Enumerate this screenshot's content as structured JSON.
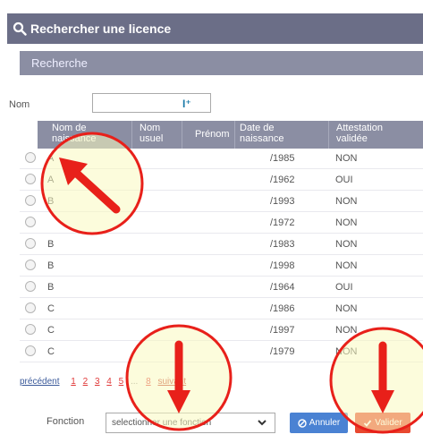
{
  "dialog": {
    "title": "Rechercher une licence",
    "section_title": "Recherche"
  },
  "search": {
    "nom_label": "Nom",
    "nom_value": ""
  },
  "table": {
    "headers": {
      "nom_naissance": "Nom de naissance",
      "nom_usuel": "Nom usuel",
      "prenom": "Prénom",
      "date_naissance": "Date de naissance",
      "attestation": "Attestation validée"
    },
    "rows": [
      {
        "initial": "A",
        "date": "/1985",
        "attestation": "NON"
      },
      {
        "initial": "A",
        "date": "/1962",
        "attestation": "OUI"
      },
      {
        "initial": "B",
        "date": "/1993",
        "attestation": "NON"
      },
      {
        "initial": "",
        "date": "/1972",
        "attestation": "NON"
      },
      {
        "initial": "B",
        "date": "/1983",
        "attestation": "NON"
      },
      {
        "initial": "B",
        "date": "/1998",
        "attestation": "NON"
      },
      {
        "initial": "B",
        "date": "/1964",
        "attestation": "OUI"
      },
      {
        "initial": "C",
        "date": "/1986",
        "attestation": "NON"
      },
      {
        "initial": "C",
        "date": "/1997",
        "attestation": "NON"
      },
      {
        "initial": "C",
        "date": "/1979",
        "attestation": "NON"
      }
    ]
  },
  "pagination": {
    "previous": "précédent",
    "pages": [
      "1",
      "2",
      "3",
      "4",
      "5"
    ],
    "ellipsis": "...",
    "last": "8",
    "next": "suivant"
  },
  "footer": {
    "fonction_label": "Fonction",
    "fonction_placeholder": "selectionner une fonction",
    "cancel_label": "Annuler",
    "validate_label": "Valider"
  },
  "colors": {
    "title_bar": "#6b6e87",
    "header_bar": "#8b8ea3",
    "cancel_button": "#4a82d3",
    "validate_button": "#e8482f",
    "annotation_red": "#e8201a",
    "annotation_fill": "#fafac0"
  },
  "icons": [
    "search-icon",
    "chevron-down-icon",
    "cancel-circle-icon",
    "check-icon",
    "arrow-annotation"
  ]
}
